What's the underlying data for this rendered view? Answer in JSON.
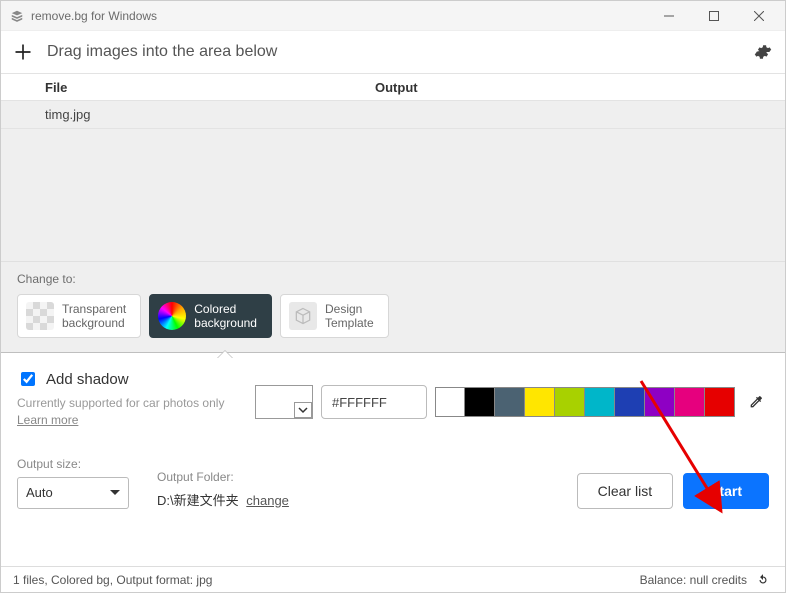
{
  "window": {
    "title": "remove.bg for Windows"
  },
  "toolbar": {
    "hint": "Drag images into the area below"
  },
  "table": {
    "headers": {
      "file": "File",
      "output": "Output"
    },
    "rows": [
      {
        "file": "timg.jpg",
        "output": ""
      }
    ]
  },
  "change_to": {
    "label": "Change to:",
    "options": [
      {
        "id": "transparent",
        "line1": "Transparent",
        "line2": "background"
      },
      {
        "id": "colored",
        "line1": "Colored",
        "line2": "background"
      },
      {
        "id": "template",
        "line1": "Design",
        "line2": "Template"
      }
    ],
    "active": "colored"
  },
  "shadow": {
    "checked": true,
    "title": "Add shadow",
    "note": "Currently supported for car photos only",
    "learn_more": "Learn more"
  },
  "color": {
    "hex": "#FFFFFF",
    "swatches": [
      "#ffffff",
      "#000000",
      "#4b6272",
      "#ffe600",
      "#a8d100",
      "#00b6c9",
      "#1e3fb3",
      "#8e00c4",
      "#e6007e",
      "#e60000"
    ]
  },
  "output": {
    "size_label": "Output size:",
    "size_value": "Auto",
    "folder_label": "Output Folder:",
    "folder_path": "D:\\新建文件夹",
    "change": "change"
  },
  "actions": {
    "clear": "Clear list",
    "start": "Start"
  },
  "status": {
    "left": "1 files, Colored bg, Output format: jpg",
    "right": "Balance: null credits"
  }
}
